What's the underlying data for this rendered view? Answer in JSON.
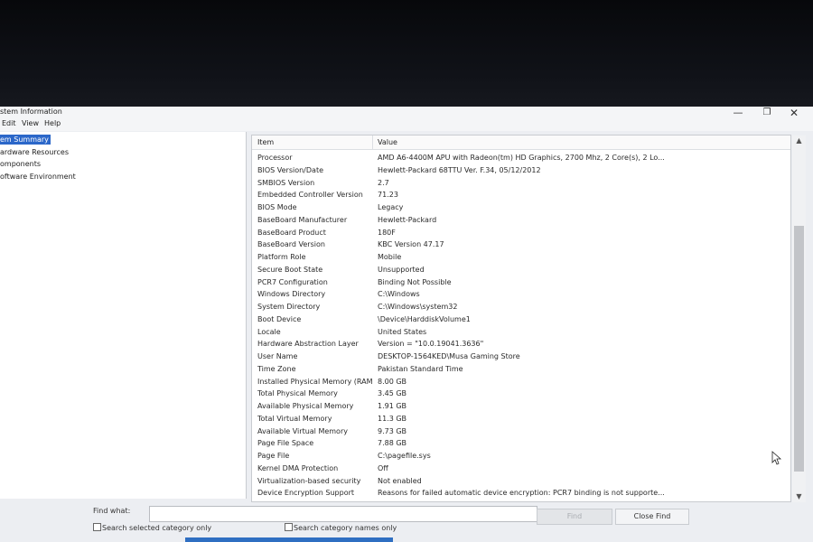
{
  "window": {
    "title": "stem Information",
    "controls": {
      "minimize": "—",
      "maximize": "❐",
      "close": "✕"
    }
  },
  "menu": [
    "Edit",
    "View",
    "Help"
  ],
  "tree": [
    {
      "label": "em Summary",
      "selected": true
    },
    {
      "label": "ardware Resources",
      "selected": false
    },
    {
      "label": "omponents",
      "selected": false
    },
    {
      "label": "oftware Environment",
      "selected": false
    }
  ],
  "list": {
    "headers": {
      "item": "Item",
      "value": "Value"
    },
    "rows": [
      {
        "item": "Processor",
        "value": "AMD A6-4400M APU with Radeon(tm) HD Graphics, 2700 Mhz, 2 Core(s), 2 Lo..."
      },
      {
        "item": "BIOS Version/Date",
        "value": "Hewlett-Packard 68TTU Ver. F.34, 05/12/2012"
      },
      {
        "item": "SMBIOS Version",
        "value": "2.7"
      },
      {
        "item": "Embedded Controller Version",
        "value": "71.23"
      },
      {
        "item": "BIOS Mode",
        "value": "Legacy"
      },
      {
        "item": "BaseBoard Manufacturer",
        "value": "Hewlett-Packard"
      },
      {
        "item": "BaseBoard Product",
        "value": "180F"
      },
      {
        "item": "BaseBoard Version",
        "value": "KBC Version 47.17"
      },
      {
        "item": "Platform Role",
        "value": "Mobile"
      },
      {
        "item": "Secure Boot State",
        "value": "Unsupported"
      },
      {
        "item": "PCR7 Configuration",
        "value": "Binding Not Possible"
      },
      {
        "item": "Windows Directory",
        "value": "C:\\Windows"
      },
      {
        "item": "System Directory",
        "value": "C:\\Windows\\system32"
      },
      {
        "item": "Boot Device",
        "value": "\\Device\\HarddiskVolume1"
      },
      {
        "item": "Locale",
        "value": "United States"
      },
      {
        "item": "Hardware Abstraction Layer",
        "value": "Version = \"10.0.19041.3636\""
      },
      {
        "item": "User Name",
        "value": "DESKTOP-1564KED\\Musa Gaming Store"
      },
      {
        "item": "Time Zone",
        "value": "Pakistan Standard Time"
      },
      {
        "item": "Installed Physical Memory (RAM)",
        "value": "8.00 GB"
      },
      {
        "item": "Total Physical Memory",
        "value": "3.45 GB"
      },
      {
        "item": "Available Physical Memory",
        "value": "1.91 GB"
      },
      {
        "item": "Total Virtual Memory",
        "value": "11.3 GB"
      },
      {
        "item": "Available Virtual Memory",
        "value": "9.73 GB"
      },
      {
        "item": "Page File Space",
        "value": "7.88 GB"
      },
      {
        "item": "Page File",
        "value": "C:\\pagefile.sys"
      },
      {
        "item": "Kernel DMA Protection",
        "value": "Off"
      },
      {
        "item": "Virtualization-based security",
        "value": "Not enabled"
      },
      {
        "item": "Device Encryption Support",
        "value": "Reasons for failed automatic device encryption: PCR7 binding is not supporte..."
      }
    ]
  },
  "scrollbar": {
    "up_icon": "▲",
    "down_icon": "▼"
  },
  "find": {
    "label": "Find what:",
    "value": "",
    "find_button": "Find",
    "close_button": "Close Find",
    "checkbox_selected_category": "Search selected category only",
    "checkbox_category_names": "Search category names only"
  },
  "colors": {
    "selection": "#2b67c9",
    "window_bg": "#eceef2"
  }
}
